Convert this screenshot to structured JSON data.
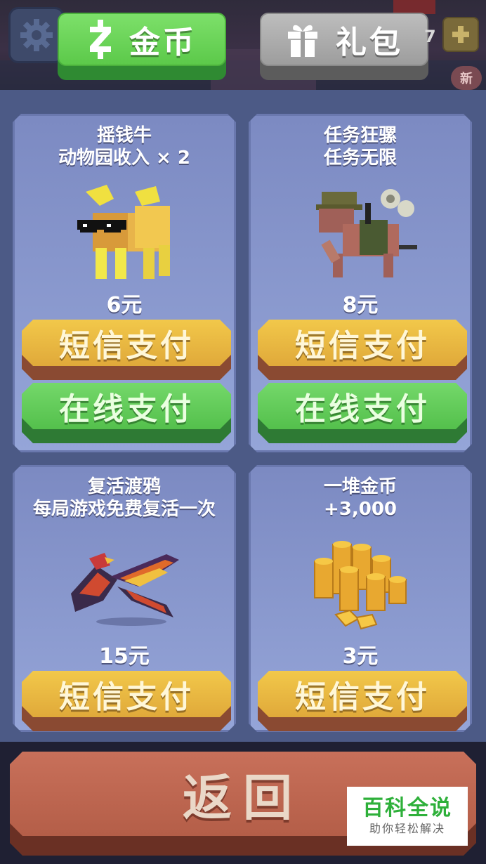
{
  "top_bar": {
    "tabs": [
      {
        "label": "金币",
        "icon": "coin-z-icon",
        "active": true
      },
      {
        "label": "礼包",
        "icon": "gift-box-icon",
        "active": false
      }
    ],
    "coin_count": "7",
    "new_badge": "新"
  },
  "shop": {
    "items": [
      {
        "title_line1": "摇钱牛",
        "title_line2": "动物园收入 × 2",
        "price": "6元",
        "icon": "money-cow-icon",
        "sms_label": "短信支付",
        "online_label": "在线支付"
      },
      {
        "title_line1": "任务狂骡",
        "title_line2": "任务无限",
        "price": "8元",
        "icon": "mission-mule-icon",
        "sms_label": "短信支付",
        "online_label": "在线支付"
      },
      {
        "title_line1": "复活渡鸦",
        "title_line2": "每局游戏免费复活一次",
        "price": "15元",
        "icon": "revive-raven-icon",
        "sms_label": "短信支付"
      },
      {
        "title_line1": "一堆金币",
        "title_line2": "+3,000",
        "price": "3元",
        "icon": "coin-pile-icon",
        "sms_label": "短信支付"
      }
    ]
  },
  "back_button": {
    "label": "返回"
  },
  "watermark": {
    "title": "百科全说",
    "subtitle": "助你轻松解决"
  },
  "colors": {
    "green_button": "#5cc94a",
    "yellow_button": "#e8b83e",
    "back_button": "#b45e48",
    "card_bg": "#8a98d0",
    "panel_bg": "#4c5a86"
  }
}
